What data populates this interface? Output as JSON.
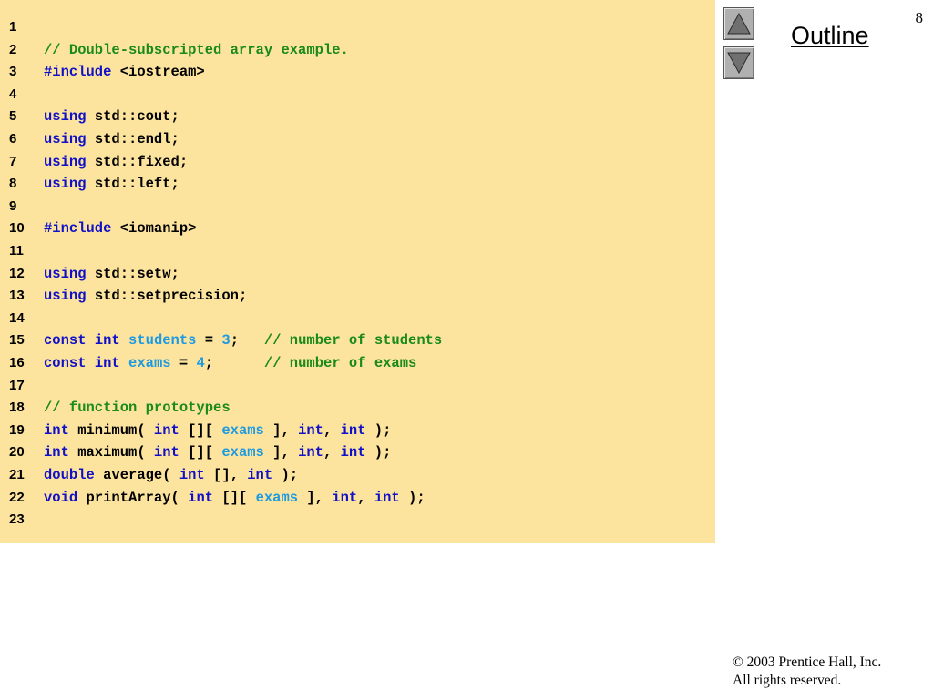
{
  "slide": {
    "page_number": "8",
    "outline_label": "Outline",
    "nav": {
      "up_icon": "triangle-up-icon",
      "down_icon": "triangle-down-icon"
    },
    "copyright": {
      "line1": "© 2003 Prentice Hall, Inc.",
      "line2": "All rights reserved."
    },
    "colors": {
      "panel_background": "#fce49e",
      "keyword": "#1010c8",
      "comment": "#1a8a1a",
      "identifier": "#1e9ae0",
      "plain": "#000000"
    }
  },
  "code": {
    "lines": [
      {
        "number": "1",
        "tokens": []
      },
      {
        "number": "2",
        "tokens": [
          {
            "text": "// Double-subscripted array example.",
            "type": "cmt"
          }
        ]
      },
      {
        "number": "3",
        "tokens": [
          {
            "text": "#include",
            "type": "kw"
          },
          {
            "text": " <iostream>",
            "type": "plain"
          }
        ]
      },
      {
        "number": "4",
        "tokens": []
      },
      {
        "number": "5",
        "tokens": [
          {
            "text": "using",
            "type": "kw"
          },
          {
            "text": " std::cout;",
            "type": "plain"
          }
        ]
      },
      {
        "number": "6",
        "tokens": [
          {
            "text": "using",
            "type": "kw"
          },
          {
            "text": " std::endl;",
            "type": "plain"
          }
        ]
      },
      {
        "number": "7",
        "tokens": [
          {
            "text": "using",
            "type": "kw"
          },
          {
            "text": " std::fixed;",
            "type": "plain"
          }
        ]
      },
      {
        "number": "8",
        "tokens": [
          {
            "text": "using",
            "type": "kw"
          },
          {
            "text": " std::left;",
            "type": "plain"
          }
        ]
      },
      {
        "number": "9",
        "tokens": []
      },
      {
        "number": "10",
        "tokens": [
          {
            "text": "#include",
            "type": "kw"
          },
          {
            "text": " <iomanip>",
            "type": "plain"
          }
        ]
      },
      {
        "number": "11",
        "tokens": []
      },
      {
        "number": "12",
        "tokens": [
          {
            "text": "using",
            "type": "kw"
          },
          {
            "text": " std::setw;",
            "type": "plain"
          }
        ]
      },
      {
        "number": "13",
        "tokens": [
          {
            "text": "using",
            "type": "kw"
          },
          {
            "text": " std::setprecision;",
            "type": "plain"
          }
        ]
      },
      {
        "number": "14",
        "tokens": []
      },
      {
        "number": "15",
        "tokens": [
          {
            "text": "const",
            "type": "kw"
          },
          {
            "text": " ",
            "type": "plain"
          },
          {
            "text": "int",
            "type": "kw"
          },
          {
            "text": " ",
            "type": "plain"
          },
          {
            "text": "students",
            "type": "id"
          },
          {
            "text": " = ",
            "type": "plain"
          },
          {
            "text": "3",
            "type": "id"
          },
          {
            "text": ";   ",
            "type": "plain"
          },
          {
            "text": "// number of students",
            "type": "cmt"
          }
        ]
      },
      {
        "number": "16",
        "tokens": [
          {
            "text": "const",
            "type": "kw"
          },
          {
            "text": " ",
            "type": "plain"
          },
          {
            "text": "int",
            "type": "kw"
          },
          {
            "text": " ",
            "type": "plain"
          },
          {
            "text": "exams",
            "type": "id"
          },
          {
            "text": " = ",
            "type": "plain"
          },
          {
            "text": "4",
            "type": "id"
          },
          {
            "text": ";      ",
            "type": "plain"
          },
          {
            "text": "// number of exams",
            "type": "cmt"
          }
        ]
      },
      {
        "number": "17",
        "tokens": []
      },
      {
        "number": "18",
        "tokens": [
          {
            "text": "// function prototypes",
            "type": "cmt"
          }
        ]
      },
      {
        "number": "19",
        "tokens": [
          {
            "text": "int",
            "type": "kw"
          },
          {
            "text": " minimum( ",
            "type": "plain"
          },
          {
            "text": "int",
            "type": "kw"
          },
          {
            "text": " [][ ",
            "type": "plain"
          },
          {
            "text": "exams",
            "type": "id"
          },
          {
            "text": " ], ",
            "type": "plain"
          },
          {
            "text": "int",
            "type": "kw"
          },
          {
            "text": ", ",
            "type": "plain"
          },
          {
            "text": "int",
            "type": "kw"
          },
          {
            "text": " );",
            "type": "plain"
          }
        ]
      },
      {
        "number": "20",
        "tokens": [
          {
            "text": "int",
            "type": "kw"
          },
          {
            "text": " maximum( ",
            "type": "plain"
          },
          {
            "text": "int",
            "type": "kw"
          },
          {
            "text": " [][ ",
            "type": "plain"
          },
          {
            "text": "exams",
            "type": "id"
          },
          {
            "text": " ], ",
            "type": "plain"
          },
          {
            "text": "int",
            "type": "kw"
          },
          {
            "text": ", ",
            "type": "plain"
          },
          {
            "text": "int",
            "type": "kw"
          },
          {
            "text": " );",
            "type": "plain"
          }
        ]
      },
      {
        "number": "21",
        "tokens": [
          {
            "text": "double",
            "type": "kw"
          },
          {
            "text": " average( ",
            "type": "plain"
          },
          {
            "text": "int",
            "type": "kw"
          },
          {
            "text": " [], ",
            "type": "plain"
          },
          {
            "text": "int",
            "type": "kw"
          },
          {
            "text": " );",
            "type": "plain"
          }
        ]
      },
      {
        "number": "22",
        "tokens": [
          {
            "text": "void",
            "type": "kw"
          },
          {
            "text": " printArray( ",
            "type": "plain"
          },
          {
            "text": "int",
            "type": "kw"
          },
          {
            "text": " [][ ",
            "type": "plain"
          },
          {
            "text": "exams",
            "type": "id"
          },
          {
            "text": " ], ",
            "type": "plain"
          },
          {
            "text": "int",
            "type": "kw"
          },
          {
            "text": ", ",
            "type": "plain"
          },
          {
            "text": "int",
            "type": "kw"
          },
          {
            "text": " );",
            "type": "plain"
          }
        ]
      },
      {
        "number": "23",
        "tokens": []
      }
    ]
  }
}
